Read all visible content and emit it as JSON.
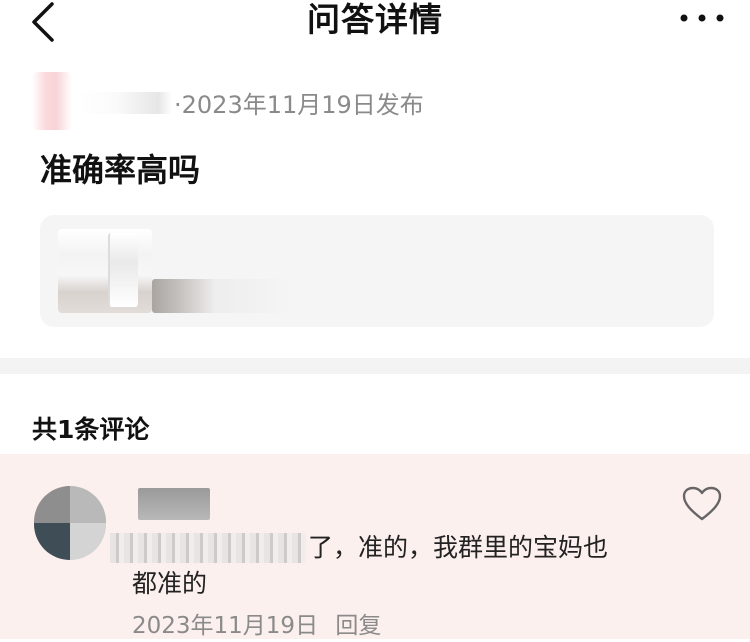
{
  "nav": {
    "title": "问答详情"
  },
  "question": {
    "publish_meta": "·2023年11月19日发布",
    "title": "准确率高吗"
  },
  "comments": {
    "count_label": "共1条评论",
    "items": [
      {
        "text_line1": "了，准的，我群里的宝妈也",
        "text_line2": "都准的",
        "date": "2023年11月19日",
        "reply_label": "回复"
      }
    ]
  },
  "colors": {
    "comment_highlight_bg": "#fcf0ee",
    "card_bg": "#f5f5f5",
    "meta_text": "#8a8a8a"
  },
  "icons": {
    "back": "chevron-left-icon",
    "more": "more-dots-icon",
    "like": "heart-outline-icon"
  }
}
